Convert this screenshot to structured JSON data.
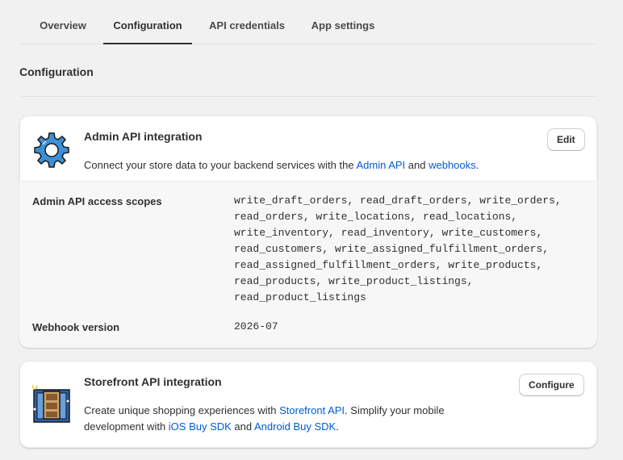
{
  "tabs": [
    {
      "label": "Overview",
      "active": false
    },
    {
      "label": "Configuration",
      "active": true
    },
    {
      "label": "API credentials",
      "active": false
    },
    {
      "label": "App settings",
      "active": false
    }
  ],
  "page_title": "Configuration",
  "admin_card": {
    "title": "Admin API integration",
    "desc_prefix": "Connect your store data to your backend services with the ",
    "link_admin_api": "Admin API",
    "desc_and": " and ",
    "link_webhooks": "webhooks",
    "desc_suffix": ".",
    "edit_label": "Edit",
    "icon": "gear-icon",
    "scopes_label": "Admin API access scopes",
    "scopes": [
      "write_draft_orders, read_draft_orders, write_orders,",
      "read_orders, write_locations, read_locations,",
      "write_inventory, read_inventory, write_customers,",
      "read_customers, write_assigned_fulfillment_orders,",
      "read_assigned_fulfillment_orders, write_products,",
      "read_products, write_product_listings,",
      "read_product_listings"
    ],
    "webhook_label": "Webhook version",
    "webhook_value": "2026-07"
  },
  "storefront_card": {
    "title": "Storefront API integration",
    "configure_label": "Configure",
    "icon": "storefront-icon",
    "desc1_prefix": "Create unique shopping experiences with ",
    "link_storefront_api": "Storefront API",
    "desc1_suffix": ". Simplify your mobile",
    "desc2_prefix": "development with ",
    "link_ios_sdk": "iOS Buy SDK",
    "desc2_and": " and ",
    "link_android_sdk": "Android Buy SDK",
    "desc2_suffix": "."
  },
  "colors": {
    "link": "#005bd3",
    "gear_blue": "#3d8fd6"
  }
}
